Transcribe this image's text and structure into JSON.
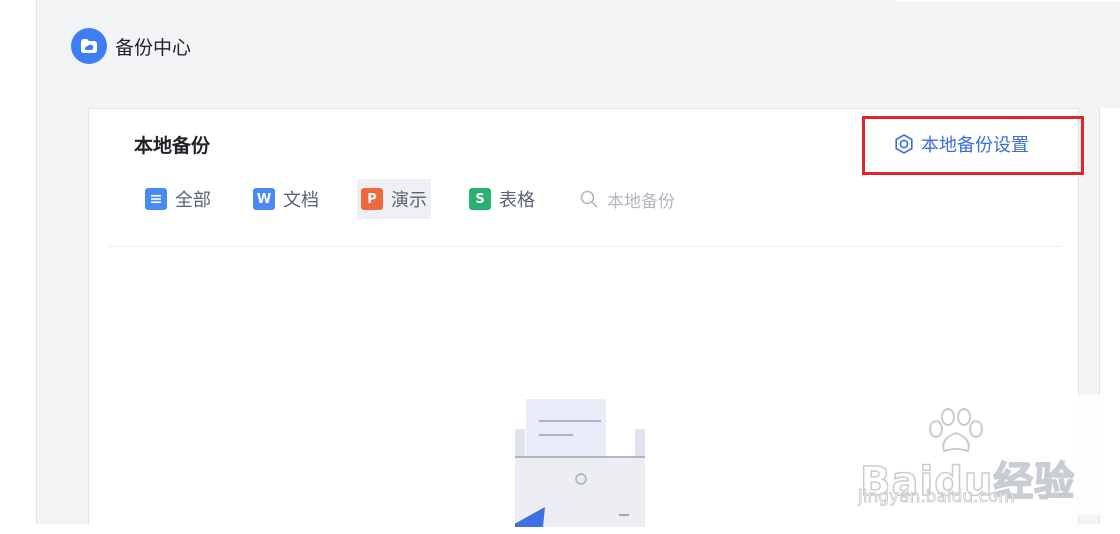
{
  "app": {
    "title": "备份中心",
    "logo_icon": "cloud-folder-icon",
    "accent": "#3d7ef2"
  },
  "local_backup": {
    "title": "本地备份",
    "settings_label": "本地备份设置",
    "settings_icon": "gear-icon",
    "highlight_color": "#e3242b"
  },
  "filters": [
    {
      "label": "全部",
      "icon": "all-icon",
      "icon_glyph": "☰",
      "color": "#4a8af4",
      "active": false
    },
    {
      "label": "文档",
      "icon": "writer-icon",
      "icon_glyph": "W",
      "color": "#4a8af4",
      "active": false
    },
    {
      "label": "演示",
      "icon": "presentation-icon",
      "icon_glyph": "P",
      "color": "#f0683e",
      "active": true
    },
    {
      "label": "表格",
      "icon": "spreadsheet-icon",
      "icon_glyph": "S",
      "color": "#28b272",
      "active": false
    }
  ],
  "search": {
    "placeholder": "本地备份",
    "icon": "search-icon"
  },
  "empty_state": {
    "icon": "printer-empty-icon"
  },
  "watermark": {
    "text": "Baidu经验",
    "sub": "jingyan.baidu.com"
  }
}
